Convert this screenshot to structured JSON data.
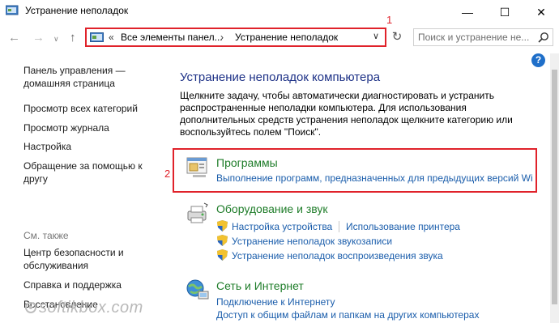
{
  "window": {
    "title": "Устранение неполадок",
    "minimize_label": "—",
    "maximize_label": "☐",
    "close_label": "✕"
  },
  "navigation": {
    "back_glyph": "←",
    "forward_glyph": "→",
    "recent_glyph": "∨",
    "up_glyph": "↑",
    "refresh_glyph": "↻"
  },
  "address": {
    "chevron": "«",
    "segment1": "Все элементы панел...",
    "separator": "›",
    "segment2": "Устранение неполадок",
    "dropdown_glyph": "∨"
  },
  "search": {
    "placeholder": "Поиск и устранение не..."
  },
  "callouts": {
    "one": "1",
    "two": "2"
  },
  "help": {
    "label": "?"
  },
  "left_nav": {
    "home_line1": "Панель управления —",
    "home_line2": "домашняя страница",
    "items": [
      "Просмотр всех категорий",
      "Просмотр журнала",
      "Настройка",
      "Обращение за помощью к",
      "другу"
    ],
    "see_also": "См. также",
    "see_also_items": [
      "Центр безопасности и",
      "обслуживания",
      "Справка и поддержка",
      "Восстановление"
    ]
  },
  "main": {
    "heading": "Устранение неполадок компьютера",
    "description": "Щелкните задачу, чтобы автоматически диагностировать и устранить распространенные неполадки компьютера. Для использования дополнительных средств устранения неполадок щелкните категорию или воспользуйтесь полем \"Поиск\".",
    "categories": [
      {
        "title": "Программы",
        "links": [
          "Выполнение программ, предназначенных для предыдущих версий Wi"
        ]
      },
      {
        "title": "Оборудование и звук",
        "links": [
          "Настройка устройства",
          "Использование принтера",
          "Устранение неполадок звукозаписи",
          "Устранение неполадок воспроизведения звука"
        ]
      },
      {
        "title": "Сеть и Интернет",
        "links": [
          "Подключение к Интернету",
          "Доступ к общим файлам и папкам на других компьютерах"
        ]
      }
    ]
  },
  "watermark": {
    "text": "softikbox.com"
  }
}
